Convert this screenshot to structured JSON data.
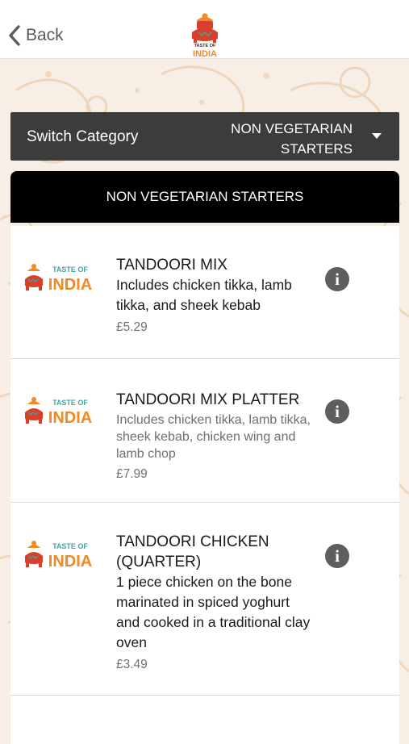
{
  "header": {
    "back_label": "Back",
    "logo_text_top": "TASTE OF",
    "logo_text_main": "INDIA"
  },
  "switch_category": {
    "label": "Switch Category",
    "value_line1": "NON VEGETARIAN",
    "value_line2": "STARTERS"
  },
  "category_title": "NON VEGETARIAN STARTERS",
  "items": [
    {
      "thumb_top": "TASTE OF",
      "thumb_main": "INDIA",
      "name": "TANDOORI MIX",
      "description": "Includes chicken tikka, lamb tikka, and sheek kebab",
      "price": "£5.29",
      "info_icon": "info-icon"
    },
    {
      "thumb_top": "TASTE OF",
      "thumb_main": "INDIA",
      "name": "TANDOORI MIX PLATTER",
      "description": "Includes chicken tikka, lamb tikka, sheek kebab, chicken wing and lamb chop",
      "price": "£7.99",
      "info_icon": "info-icon"
    },
    {
      "thumb_top": "TASTE OF",
      "thumb_main": "INDIA",
      "name": "TANDOORI CHICKEN (QUARTER)",
      "description": "1 piece chicken on the bone marinated in spiced yoghurt and cooked in a traditional clay oven",
      "price": "£3.49",
      "info_icon": "info-icon"
    }
  ],
  "colors": {
    "accent_orange": "#f08a24",
    "logo_red": "#d8402c",
    "background": "#f7efe6",
    "dark_bar": "#3c3c3c"
  }
}
